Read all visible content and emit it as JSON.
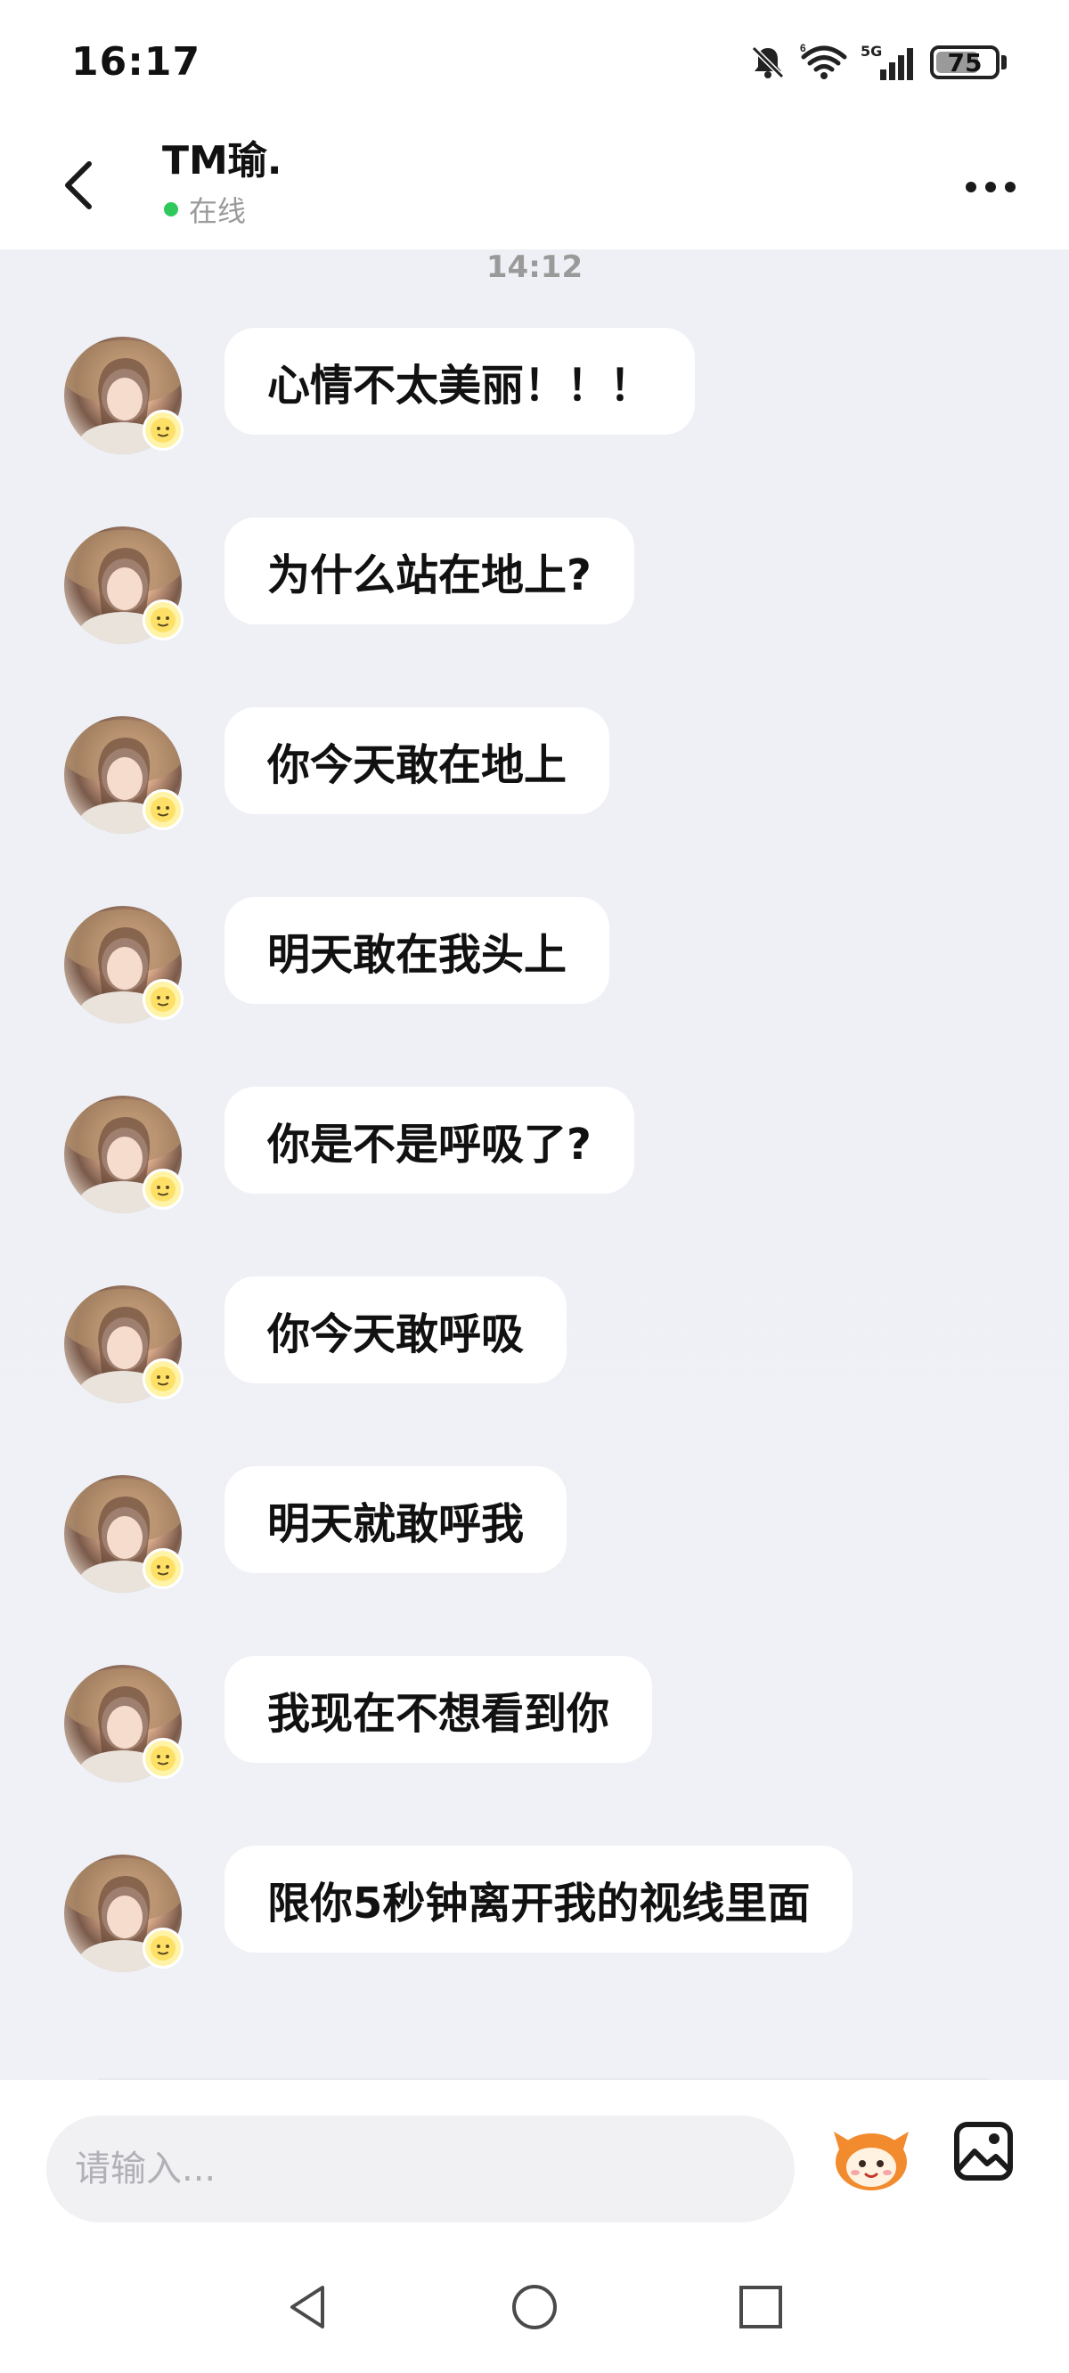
{
  "status_bar": {
    "time": "16:17",
    "battery": "75",
    "battery_level": 0.75,
    "network": "5G"
  },
  "header": {
    "name": "TM瑜.",
    "status": "在线",
    "status_color": "#2fc85a"
  },
  "chat": {
    "timestamp": "14:12",
    "messages": [
      {
        "text": "心情不太美丽！！！"
      },
      {
        "text": "为什么站在地上?"
      },
      {
        "text": "你今天敢在地上"
      },
      {
        "text": "明天敢在我头上"
      },
      {
        "text": "你是不是呼吸了?"
      },
      {
        "text": "你今天敢呼吸"
      },
      {
        "text": "明天就敢呼我"
      },
      {
        "text": "我现在不想看到你"
      },
      {
        "text": "限你5秒钟离开我的视线里面"
      }
    ]
  },
  "input": {
    "placeholder": "请输入..."
  },
  "icons": {
    "back": "chevron-left-icon",
    "more": "more-dots-icon",
    "emoji": "mascot-emoji-icon",
    "image": "image-icon",
    "nav_back": "triangle-back-icon",
    "nav_home": "circle-home-icon",
    "nav_recent": "square-recent-icon"
  }
}
